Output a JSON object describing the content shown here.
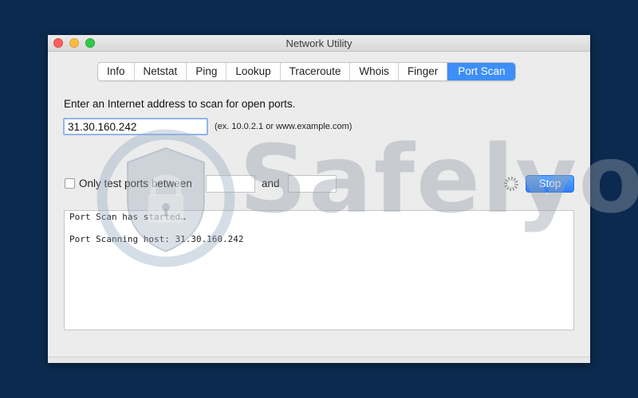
{
  "window": {
    "title": "Network Utility"
  },
  "tabs": [
    {
      "label": "Info",
      "active": false
    },
    {
      "label": "Netstat",
      "active": false
    },
    {
      "label": "Ping",
      "active": false
    },
    {
      "label": "Lookup",
      "active": false
    },
    {
      "label": "Traceroute",
      "active": false
    },
    {
      "label": "Whois",
      "active": false
    },
    {
      "label": "Finger",
      "active": false
    },
    {
      "label": "Port Scan",
      "active": true
    }
  ],
  "portscan": {
    "prompt": "Enter an Internet address to scan for open ports.",
    "address_value": "31.30.160.242",
    "address_hint": "(ex. 10.0.2.1 or www.example.com)",
    "only_ports_label": "Only test ports between",
    "only_ports_checked": false,
    "and_label": "and",
    "port_from_value": "",
    "port_to_value": "",
    "stop_label": "Stop",
    "output_lines": [
      "Port Scan has started…",
      "",
      "Port Scanning host: 31.30.160.242"
    ]
  },
  "watermark": {
    "text": "Safelyo"
  },
  "colors": {
    "background": "#0c2a4f",
    "accent": "#3d8ef7",
    "close": "#fc605c",
    "minimize": "#fdbc40",
    "maximize": "#34c84a"
  }
}
